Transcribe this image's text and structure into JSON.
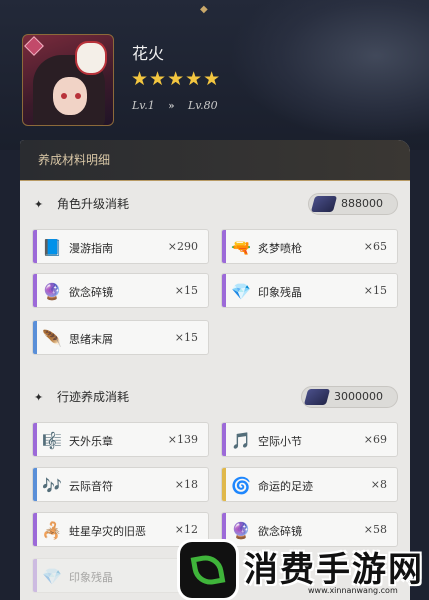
{
  "character": {
    "name": "花火",
    "stars": "★★★★★",
    "level_from": "Lv.1",
    "level_arrow": "»",
    "level_to": "Lv.80"
  },
  "panel": {
    "title": "养成材料明细"
  },
  "sections": [
    {
      "title": "角色升级消耗",
      "cost": "888000",
      "items": [
        {
          "name": "漫游指南",
          "qty": "×290",
          "icon": "book-icon",
          "rarity": "purple"
        },
        {
          "name": "炙梦喷枪",
          "qty": "×65",
          "icon": "spray-gun-icon",
          "rarity": "purple"
        },
        {
          "name": "欲念碎镜",
          "qty": "×15",
          "icon": "mirror-shard-icon",
          "rarity": "purple"
        },
        {
          "name": "印象残晶",
          "qty": "×15",
          "icon": "crystal-icon",
          "rarity": "purple"
        },
        {
          "name": "思绪末屑",
          "qty": "×15",
          "icon": "shard-icon",
          "rarity": "blue"
        }
      ]
    },
    {
      "title": "行迹养成消耗",
      "cost": "3000000",
      "items": [
        {
          "name": "天外乐章",
          "qty": "×139",
          "icon": "music-score-icon",
          "rarity": "purple"
        },
        {
          "name": "空际小节",
          "qty": "×69",
          "icon": "music-note-icon",
          "rarity": "purple"
        },
        {
          "name": "云际音符",
          "qty": "×18",
          "icon": "note-icon",
          "rarity": "blue"
        },
        {
          "name": "命运的足迹",
          "qty": "×8",
          "icon": "footprint-icon",
          "rarity": "gold"
        },
        {
          "name": "蛀星孕灾的旧恶",
          "qty": "×12",
          "icon": "claw-icon",
          "rarity": "purple"
        },
        {
          "name": "欲念碎镜",
          "qty": "×58",
          "icon": "mirror-shard-icon",
          "rarity": "purple"
        },
        {
          "name": "印象残晶",
          "qty": "",
          "icon": "crystal-icon",
          "rarity": "purple"
        }
      ]
    }
  ],
  "watermark": {
    "text": "消费手游网",
    "url": "www.xinnanwang.com"
  }
}
